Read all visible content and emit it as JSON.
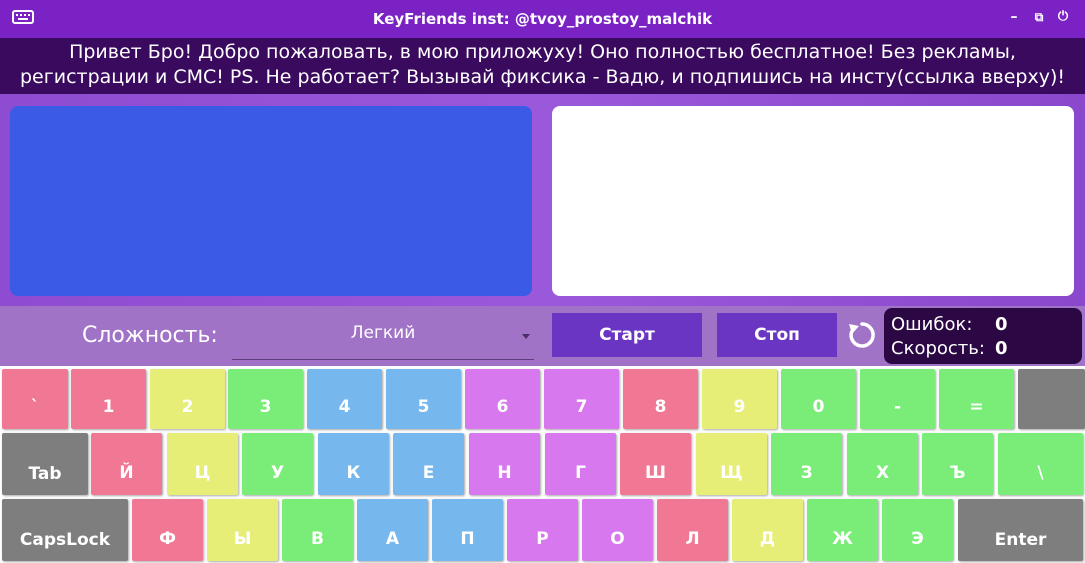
{
  "window": {
    "title": "KeyFriends inst: @tvoy_prostoy_malchik",
    "icon": "keyboard-icon",
    "controls": [
      "minimize-icon",
      "restore-icon",
      "power-icon"
    ],
    "minimize_glyph": "–",
    "restore_glyph": "⧉",
    "power_glyph": "⏻"
  },
  "banner": {
    "line1": "Привет Бро! Добро пожаловать, в мою приложуху! Оно полностью бесплатное! Без рекламы,",
    "line2": "регистрации и СМС! PS. Не работает? Вызывай фиксика - Вадю, и подпишись на инсту(ссылка вверху)!"
  },
  "controls": {
    "difficulty_label": "Сложность:",
    "difficulty_value": "Легкий",
    "start_label": "Старт",
    "stop_label": "Стоп",
    "errors_label": "Ошибок:",
    "errors_value": "0",
    "speed_label": "Скорость:",
    "speed_value": "0"
  },
  "colors": {
    "pink": "#f07894",
    "yellow": "#e6ee78",
    "green": "#7aec78",
    "blue": "#76b8ee",
    "violet": "#d878ee",
    "gray": "#7e7e7e",
    "accent": "#7b22c4",
    "button": "#6a35c2"
  },
  "keyboard": {
    "row0": [
      {
        "label": "`",
        "color": "pink"
      },
      {
        "label": "1",
        "color": "pink"
      },
      {
        "label": "2",
        "color": "yellow"
      },
      {
        "label": "3",
        "color": "green"
      },
      {
        "label": "4",
        "color": "blue"
      },
      {
        "label": "5",
        "color": "blue"
      },
      {
        "label": "6",
        "color": "violet"
      },
      {
        "label": "7",
        "color": "violet"
      },
      {
        "label": "8",
        "color": "pink"
      },
      {
        "label": "9",
        "color": "yellow"
      },
      {
        "label": "0",
        "color": "green"
      },
      {
        "label": "-",
        "color": "green"
      },
      {
        "label": "=",
        "color": "green"
      },
      {
        "label": "",
        "color": "gray"
      }
    ],
    "row1": [
      {
        "label": "Tab",
        "color": "gray"
      },
      {
        "label": "Й",
        "color": "pink"
      },
      {
        "label": "Ц",
        "color": "yellow"
      },
      {
        "label": "У",
        "color": "green"
      },
      {
        "label": "К",
        "color": "blue"
      },
      {
        "label": "Е",
        "color": "blue"
      },
      {
        "label": "Н",
        "color": "violet"
      },
      {
        "label": "Г",
        "color": "violet"
      },
      {
        "label": "Ш",
        "color": "pink"
      },
      {
        "label": "Щ",
        "color": "yellow"
      },
      {
        "label": "З",
        "color": "green"
      },
      {
        "label": "Х",
        "color": "green"
      },
      {
        "label": "Ъ",
        "color": "green"
      },
      {
        "label": "\\",
        "color": "green"
      }
    ],
    "row2": [
      {
        "label": "CapsLock",
        "color": "gray"
      },
      {
        "label": "Ф",
        "color": "pink"
      },
      {
        "label": "Ы",
        "color": "yellow"
      },
      {
        "label": "В",
        "color": "green"
      },
      {
        "label": "А",
        "color": "blue"
      },
      {
        "label": "П",
        "color": "blue"
      },
      {
        "label": "Р",
        "color": "violet"
      },
      {
        "label": "О",
        "color": "violet"
      },
      {
        "label": "Л",
        "color": "pink"
      },
      {
        "label": "Д",
        "color": "yellow"
      },
      {
        "label": "Ж",
        "color": "green"
      },
      {
        "label": "Э",
        "color": "green"
      },
      {
        "label": "Enter",
        "color": "gray"
      }
    ]
  }
}
